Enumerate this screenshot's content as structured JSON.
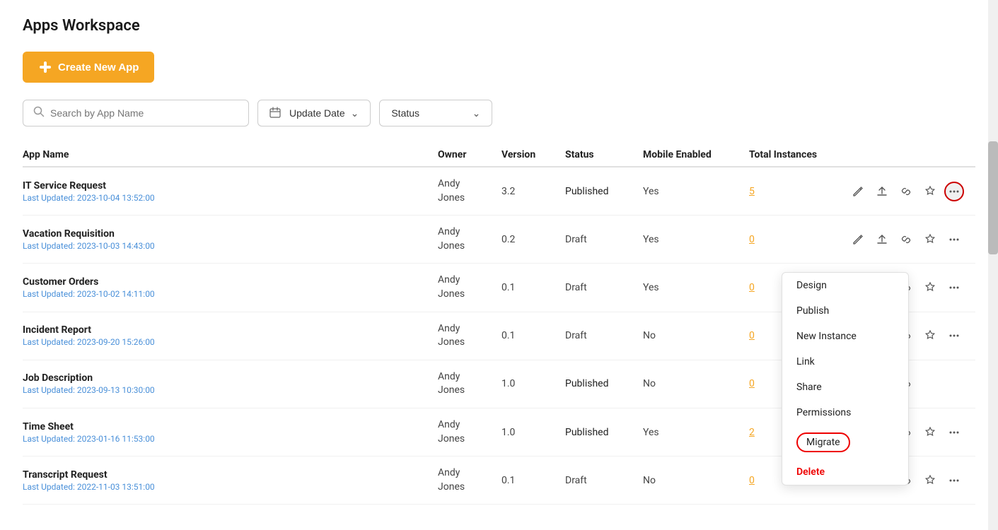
{
  "page": {
    "title": "Apps Workspace"
  },
  "toolbar": {
    "create_button_label": "Create New App",
    "search_placeholder": "Search by App Name",
    "update_date_label": "Update Date",
    "status_label": "Status"
  },
  "table": {
    "headers": [
      "App Name",
      "Owner",
      "Version",
      "Status",
      "Mobile Enabled",
      "Total Instances",
      ""
    ],
    "rows": [
      {
        "name": "IT Service Request",
        "updated": "Last Updated: 2023-10-04 13:52:00",
        "owner": "Andy\nJones",
        "version": "3.2",
        "status": "Published",
        "mobile": "Yes",
        "instances": "5",
        "has_menu": true
      },
      {
        "name": "Vacation Requisition",
        "updated": "Last Updated: 2023-10-03 14:43:00",
        "owner": "Andy\nJones",
        "version": "0.2",
        "status": "Draft",
        "mobile": "Yes",
        "instances": "0",
        "has_menu": false
      },
      {
        "name": "Customer Orders",
        "updated": "Last Updated: 2023-10-02 14:11:00",
        "owner": "Andy\nJones",
        "version": "0.1",
        "status": "Draft",
        "mobile": "Yes",
        "instances": "0",
        "has_menu": false
      },
      {
        "name": "Incident Report",
        "updated": "Last Updated: 2023-09-20 15:26:00",
        "owner": "Andy\nJones",
        "version": "0.1",
        "status": "Draft",
        "mobile": "No",
        "instances": "0",
        "has_menu": false
      },
      {
        "name": "Job Description",
        "updated": "Last Updated: 2023-09-13 10:30:00",
        "owner": "Andy\nJones",
        "version": "1.0",
        "status": "Published",
        "mobile": "No",
        "instances": "0",
        "has_menu": false,
        "is_active_row": true
      },
      {
        "name": "Time Sheet",
        "updated": "Last Updated: 2023-01-16 11:53:00",
        "owner": "Andy\nJones",
        "version": "1.0",
        "status": "Published",
        "mobile": "Yes",
        "instances": "2",
        "has_menu": false
      },
      {
        "name": "Transcript Request",
        "updated": "Last Updated: 2022-11-03 13:51:00",
        "owner": "Andy\nJones",
        "version": "0.1",
        "status": "Draft",
        "mobile": "No",
        "instances": "0",
        "has_menu": false
      }
    ]
  },
  "context_menu": {
    "items": [
      {
        "label": "Design",
        "type": "normal"
      },
      {
        "label": "Publish",
        "type": "normal"
      },
      {
        "label": "New Instance",
        "type": "normal"
      },
      {
        "label": "Link",
        "type": "normal"
      },
      {
        "label": "Share",
        "type": "normal"
      },
      {
        "label": "Permissions",
        "type": "normal"
      },
      {
        "label": "Migrate",
        "type": "migrate"
      },
      {
        "label": "Delete",
        "type": "delete"
      }
    ]
  }
}
